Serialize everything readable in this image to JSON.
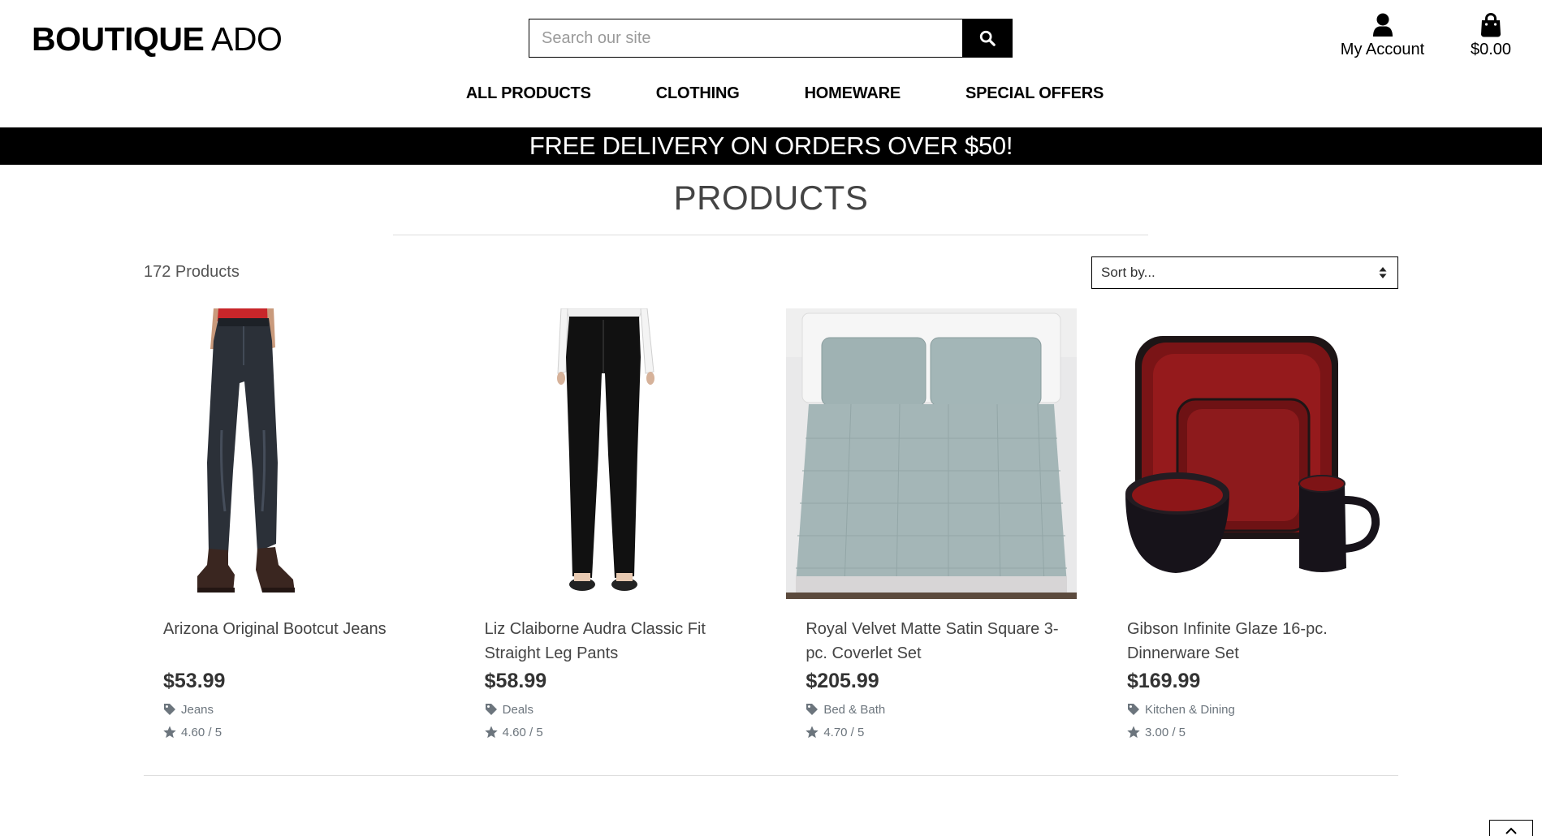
{
  "header": {
    "logo_bold": "BOUTIQUE",
    "logo_rest": "ADO",
    "search_placeholder": "Search our site",
    "account_label": "My Account",
    "bag_total": "$0.00"
  },
  "nav": [
    "ALL PRODUCTS",
    "CLOTHING",
    "HOMEWARE",
    "SPECIAL OFFERS"
  ],
  "banner": "FREE DELIVERY ON ORDERS OVER $50!",
  "page": {
    "title": "PRODUCTS",
    "count": "172 Products",
    "sort_label": "Sort by..."
  },
  "products": [
    {
      "name": "Arizona Original Bootcut Jeans",
      "price": "$53.99",
      "category": "Jeans",
      "rating": "4.60 / 5",
      "image_icon": "jeans-image"
    },
    {
      "name": "Liz Claiborne Audra Classic Fit Straight Leg Pants",
      "price": "$58.99",
      "category": "Deals",
      "rating": "4.60 / 5",
      "image_icon": "pants-image"
    },
    {
      "name": "Royal Velvet Matte Satin Square 3-pc. Coverlet Set",
      "price": "$205.99",
      "category": "Bed & Bath",
      "rating": "4.70 / 5",
      "image_icon": "coverlet-image"
    },
    {
      "name": "Gibson Infinite Glaze 16-pc. Dinnerware Set",
      "price": "$169.99",
      "category": "Kitchen & Dining",
      "rating": "3.00 / 5",
      "image_icon": "dinnerware-image"
    }
  ],
  "colors": {
    "banner_bg": "#000000",
    "banner_text": "#ffffff",
    "muted_text": "#6c757d",
    "price_text": "#333333"
  }
}
